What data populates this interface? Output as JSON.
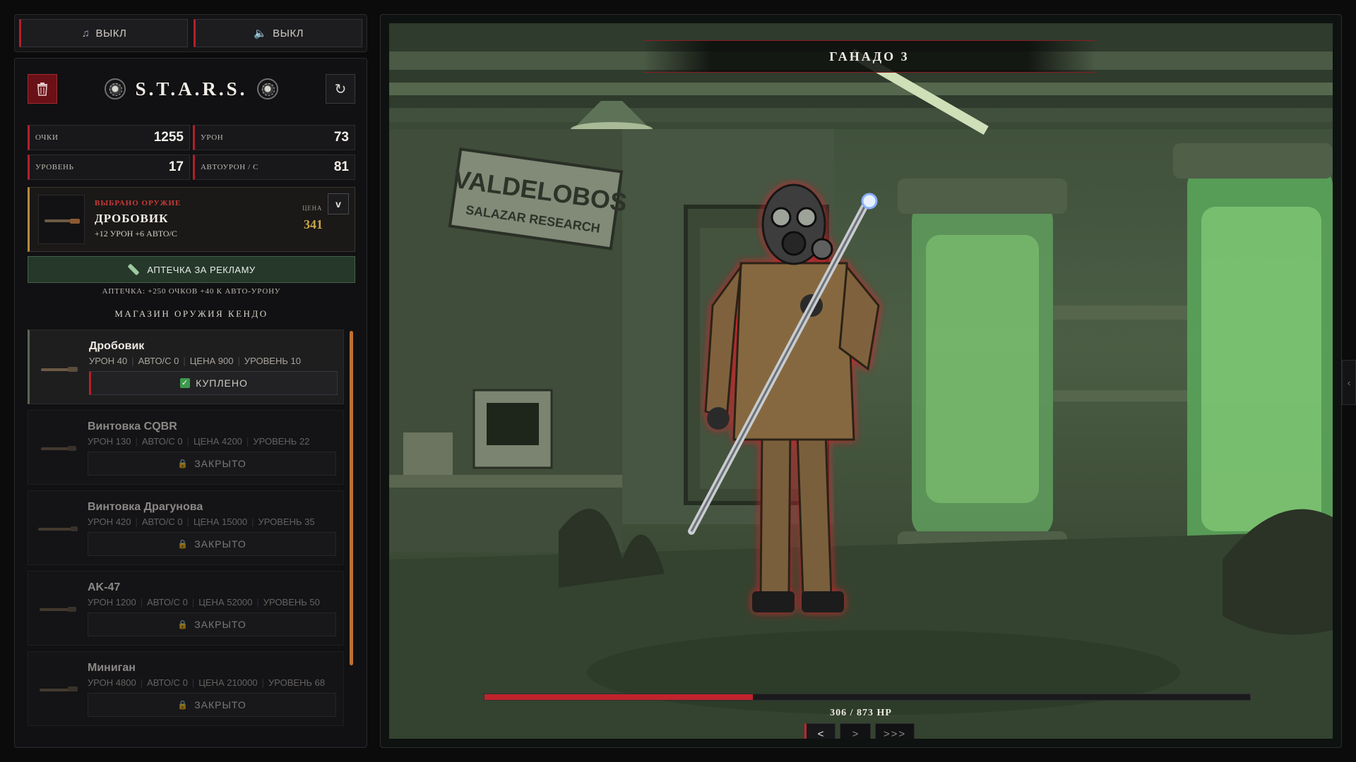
{
  "audio": {
    "music": {
      "icon": "music-note-icon",
      "label": "ВЫКЛ"
    },
    "sound": {
      "icon": "speaker-icon",
      "label": "ВЫКЛ"
    }
  },
  "header": {
    "title": "S.T.A.R.S.",
    "refresh_symbol": "↻"
  },
  "stats": {
    "points_label": "ОЧКИ",
    "points": "1255",
    "damage_label": "УРОН",
    "damage": "73",
    "level_label": "УРОВЕНЬ",
    "level": "17",
    "auto_label": "АВТОУРОН / С",
    "auto": "81"
  },
  "selected_weapon": {
    "label": "ВЫБРАНО ОРУЖИЕ",
    "name": "ДРОБОВИК",
    "bonus": "+12 УРОН  +6 АВТО/С",
    "price_label": "ЦЕНА",
    "price": "341",
    "dropdown": "v"
  },
  "medkit": {
    "button": "АПТЕЧКА ЗА РЕКЛАМУ",
    "note": "АПТЕЧКА: +250 ОЧКОВ +40 К АВТО-УРОНУ"
  },
  "shop": {
    "title": "МАГАЗИН ОРУЖИЯ КЕНДО",
    "items": [
      {
        "name": "Дробовик",
        "dmg": "УРОН 40",
        "auto": "АВТО/С 0",
        "price": "ЦЕНА 900",
        "level": "УРОВЕНЬ 10",
        "action": "КУПЛЕНО",
        "state": "bought"
      },
      {
        "name": "Винтовка CQBR",
        "dmg": "УРОН 130",
        "auto": "АВТО/С 0",
        "price": "ЦЕНА 4200",
        "level": "УРОВЕНЬ 22",
        "action": "ЗАКРЫТО",
        "state": "locked"
      },
      {
        "name": "Винтовка Драгунова",
        "dmg": "УРОН 420",
        "auto": "АВТО/С 0",
        "price": "ЦЕНА 15000",
        "level": "УРОВЕНЬ 35",
        "action": "ЗАКРЫТО",
        "state": "locked"
      },
      {
        "name": "AK-47",
        "dmg": "УРОН 1200",
        "auto": "АВТО/С 0",
        "price": "ЦЕНА 52000",
        "level": "УРОВЕНЬ 50",
        "action": "ЗАКРЫТО",
        "state": "locked"
      },
      {
        "name": "Миниган",
        "dmg": "УРОН 4800",
        "auto": "АВТО/С 0",
        "price": "ЦЕНА 210000",
        "level": "УРОВЕНЬ 68",
        "action": "ЗАКРЫТО",
        "state": "locked"
      }
    ]
  },
  "enemy": {
    "name": "ГАНАДО 3",
    "hp_text": "306 / 873 HP",
    "hp_current": 306,
    "hp_max": 873,
    "sign_line1": "VALDELOBOS",
    "sign_line2": "SALAZAR RESEARCH"
  },
  "nav": {
    "prev": "<",
    "next": ">",
    "skip": ">>>"
  },
  "side_tab": "‹",
  "colors": {
    "accent_red": "#b3202a",
    "hp_red": "#c0242c",
    "price_gold": "#c9a54d",
    "medkit_green": "#26382a"
  }
}
